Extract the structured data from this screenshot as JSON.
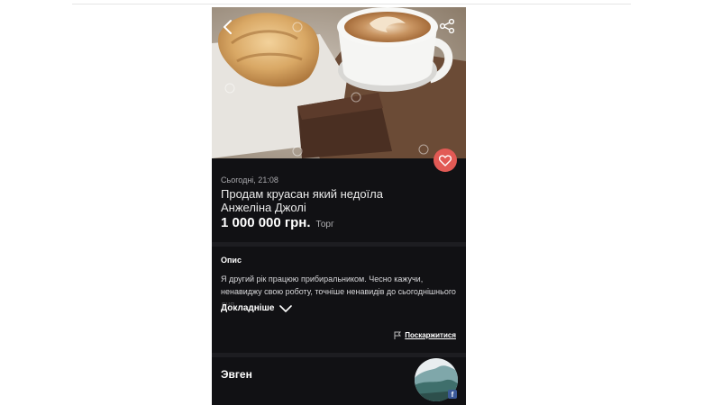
{
  "listing": {
    "date": "Сьогодні, 21:08",
    "title": "Продам круасан який недоїла Анжеліна Джолі",
    "price": "1 000 000 грн.",
    "negotiable": "Торг"
  },
  "description": {
    "heading": "Опис",
    "text": "Я другий рік працюю прибиральником. Чесно кажучи, ненавиджу свою роботу, точніше ненавидів до сьогоднішнього дня.",
    "more_label": "Докладніше"
  },
  "report": {
    "label": "Поскаржитися"
  },
  "seller": {
    "name": "Эвген",
    "social_badge": "f"
  },
  "icons": {
    "back": "chevron-left-icon",
    "share": "share-icon",
    "favorite": "heart-icon",
    "more": "chevron-down-icon",
    "report": "flag-icon"
  },
  "colors": {
    "background": "#111114",
    "favorite": "#e25a55",
    "text": "#ffffff"
  }
}
